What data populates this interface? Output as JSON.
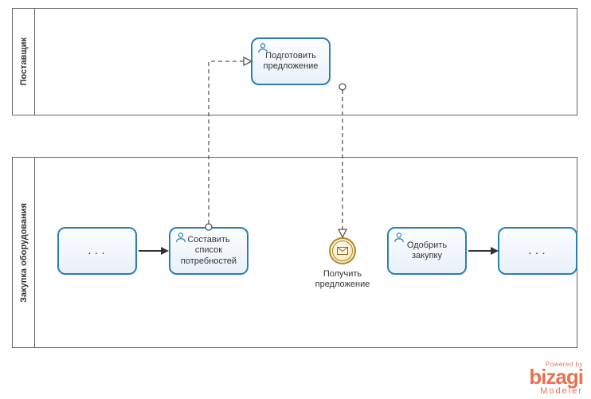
{
  "pools": {
    "supplier": {
      "label": "Поставщик"
    },
    "procurement": {
      "label": "Закупка оборудования"
    }
  },
  "tasks": {
    "prepare_offer": {
      "label": "Подготовить предложение"
    },
    "compose_list": {
      "label": "Составить список потребностей"
    },
    "approve": {
      "label": "Одобрить закупку"
    }
  },
  "events": {
    "receive_offer": {
      "label": "Получить предложение"
    }
  },
  "subprocess": {
    "placeholder": "..."
  },
  "branding": {
    "powered": "Powered by",
    "name": "bizagi",
    "product": "Modeler"
  },
  "chart_data": {
    "type": "bpmn-diagram",
    "pools": [
      {
        "id": "supplier",
        "name": "Поставщик"
      },
      {
        "id": "procurement",
        "name": "Закупка оборудования"
      }
    ],
    "nodes": [
      {
        "id": "sp1",
        "type": "collapsed-subprocess",
        "pool": "procurement",
        "label": "..."
      },
      {
        "id": "t_compose",
        "type": "user-task",
        "pool": "procurement",
        "label": "Составить список потребностей"
      },
      {
        "id": "t_prepare",
        "type": "user-task",
        "pool": "supplier",
        "label": "Подготовить предложение"
      },
      {
        "id": "e_receive",
        "type": "intermediate-message-catch",
        "pool": "procurement",
        "label": "Получить предложение"
      },
      {
        "id": "t_approve",
        "type": "user-task",
        "pool": "procurement",
        "label": "Одобрить закупку"
      },
      {
        "id": "sp2",
        "type": "collapsed-subprocess",
        "pool": "procurement",
        "label": "..."
      }
    ],
    "sequence_flows": [
      {
        "from": "sp1",
        "to": "t_compose"
      },
      {
        "from": "t_approve",
        "to": "sp2"
      }
    ],
    "message_flows": [
      {
        "from": "t_compose",
        "to": "t_prepare"
      },
      {
        "from": "t_prepare",
        "to": "e_receive"
      }
    ]
  }
}
